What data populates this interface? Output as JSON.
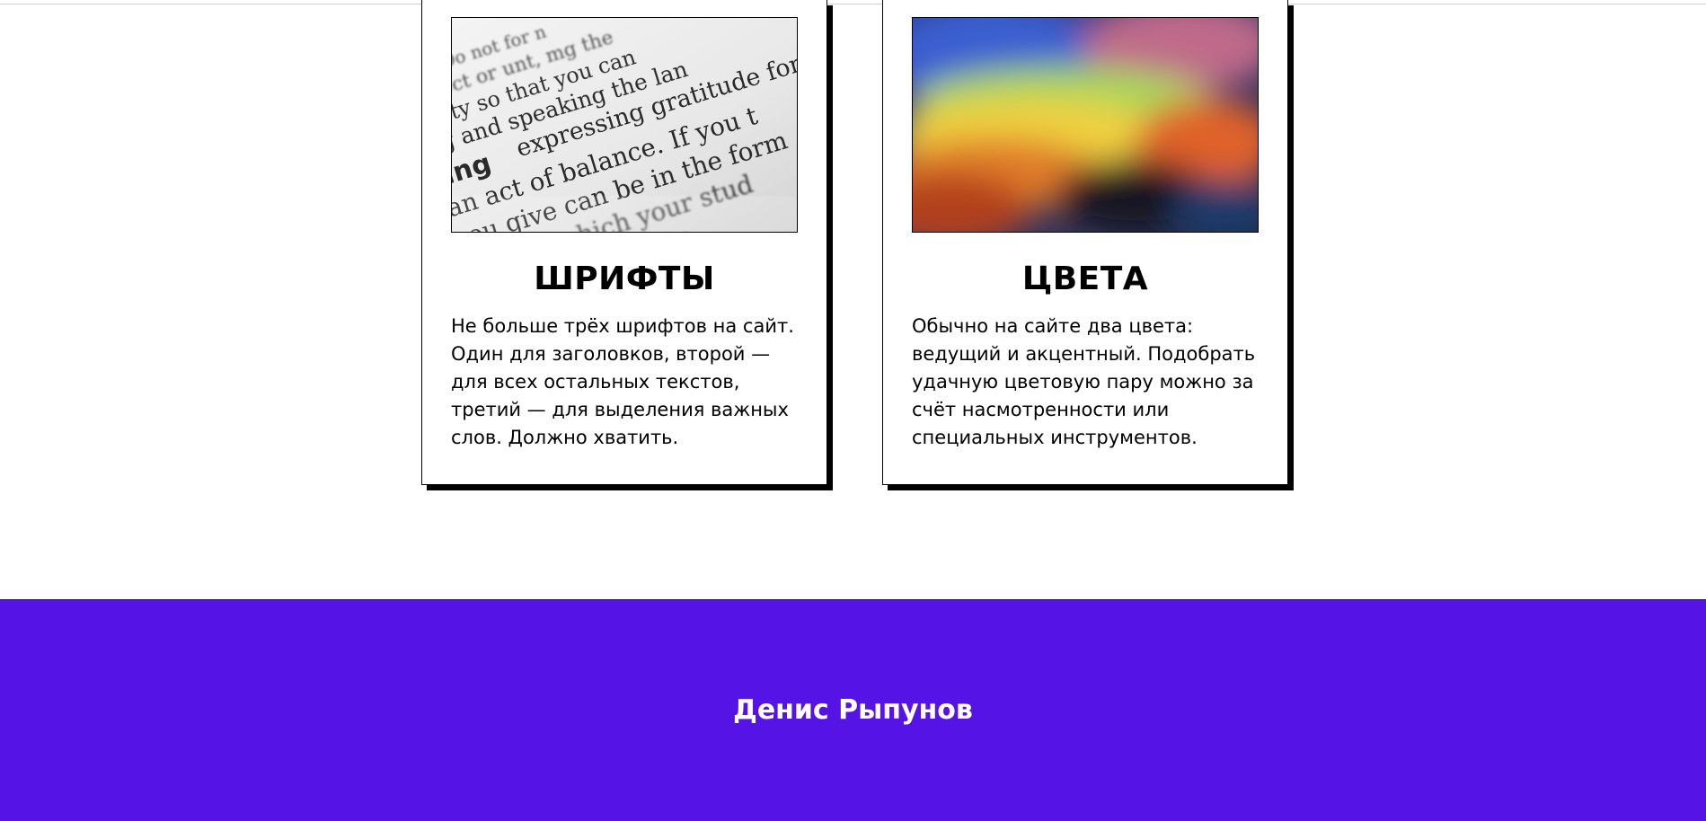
{
  "cards": [
    {
      "title": "ШРИФТЫ",
      "text": "Не больше трёх шрифтов на сайт. Один для заголовков, второй — для всех остальных текстов, третий — для выделения важных слов. Должно хватить.",
      "image_icon": "typography-photo"
    },
    {
      "title": "ЦВЕТА",
      "text": "Обычно на сайте два цвета: ведущий и акцентный. Подобрать удачную цветовую пару можно за счёт насмотренности или специальных инструментов.",
      "image_icon": "color-gradient-photo"
    }
  ],
  "footer": {
    "author": "Денис Рыпунов"
  },
  "colors": {
    "footer_background": "#5613e5",
    "footer_text": "#ffffff",
    "card_border": "#000000"
  }
}
